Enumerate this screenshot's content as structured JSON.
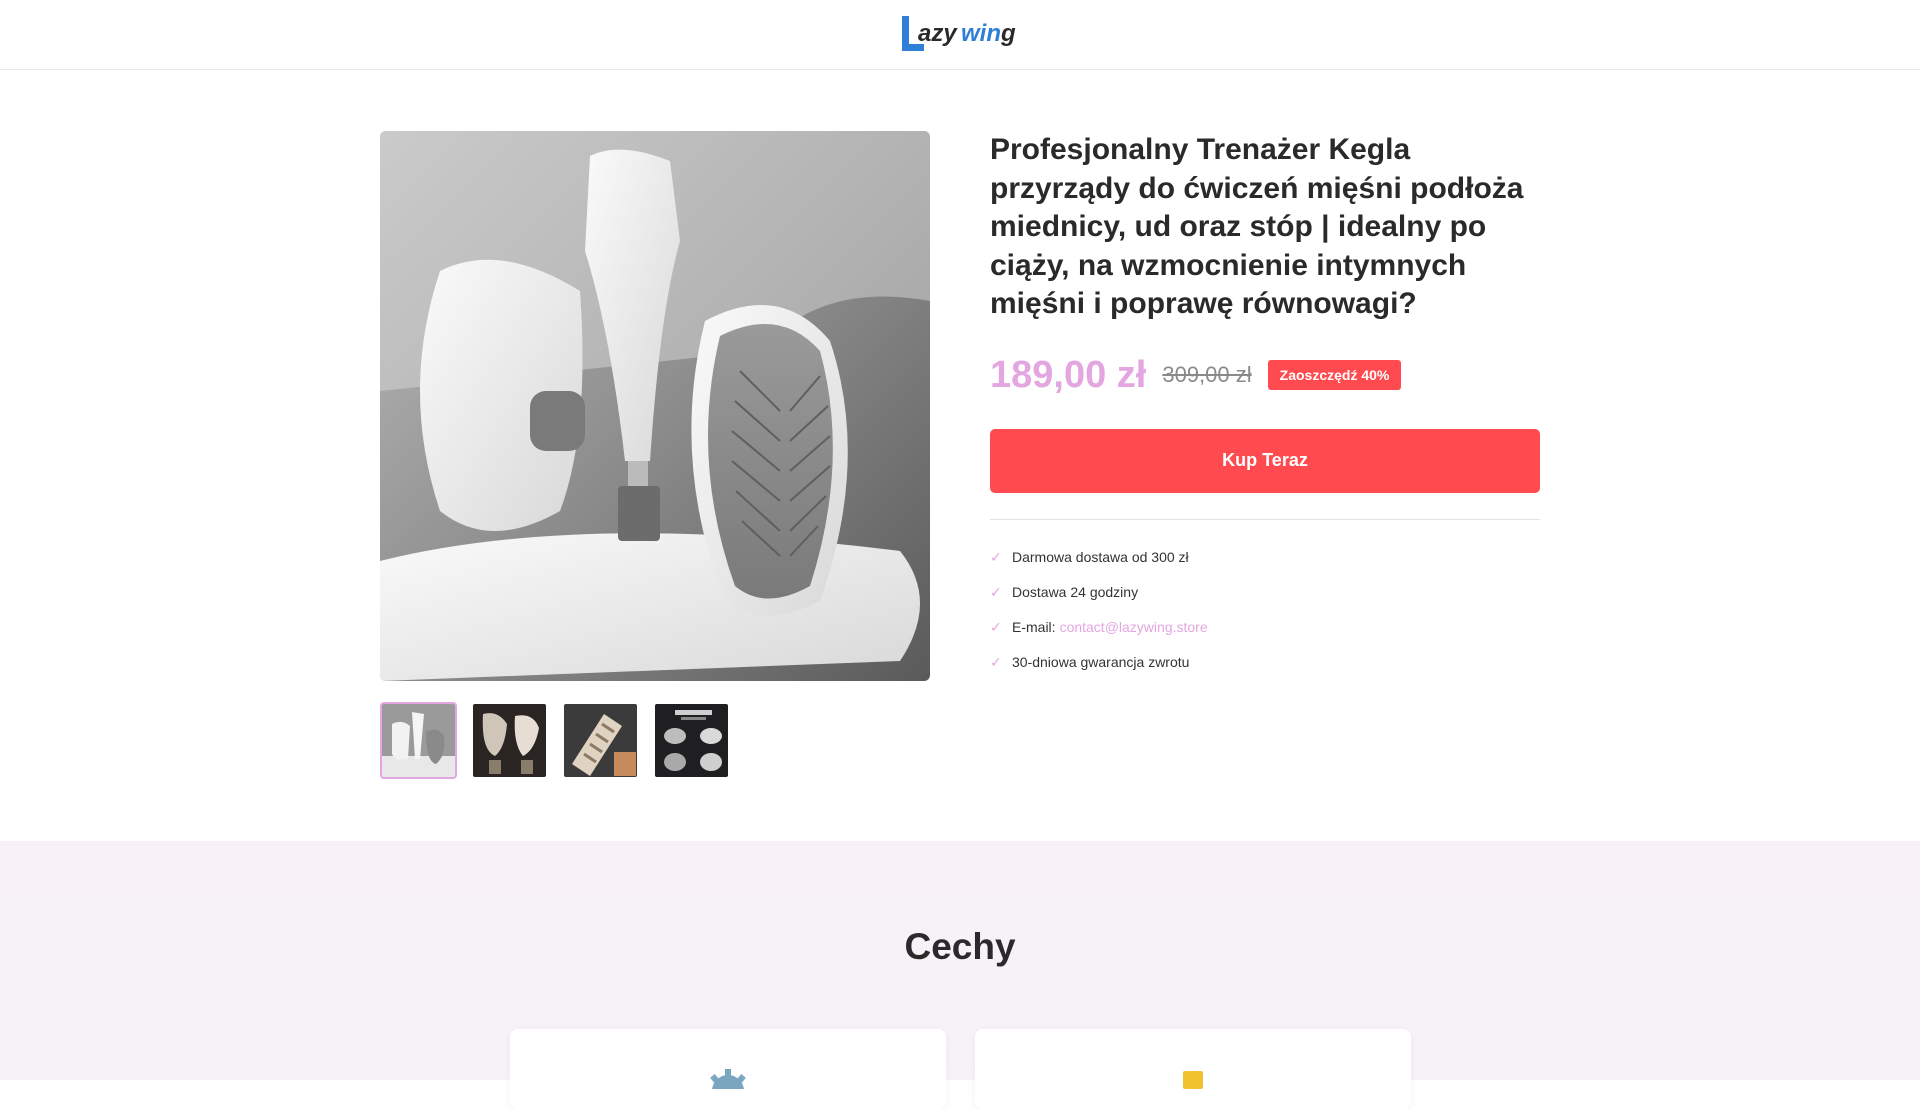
{
  "header": {
    "logo_text": "Lazywing"
  },
  "product": {
    "title": "Profesjonalny Trenażer Kegla przyrządy do ćwiczeń mięśni podłoża miednicy, ud oraz stóp | idealny po ciąży, na wzmocnienie intymnych mięśni i poprawę równowagi?",
    "price": "189,00 zł",
    "old_price": "309,00 zł",
    "save_label": "Zaoszczędź 40%",
    "buy_label": "Kup Teraz",
    "features": [
      {
        "text": "Darmowa dostawa od 300 zł"
      },
      {
        "text": "Dostawa 24 godziny"
      },
      {
        "text": "E-mail:",
        "link": "contact@lazywing.store"
      },
      {
        "text": "30-dniowa gwarancja zwrotu"
      }
    ],
    "thumbnail_count": 4,
    "active_thumbnail": 1
  },
  "features_section": {
    "title": "Cechy",
    "card_icons": [
      "gear-icon",
      "trophy-icon"
    ]
  },
  "colors": {
    "accent_pink": "#e4a6e0",
    "cta_red": "#ff4b4f",
    "logo_blue": "#2f7fd8",
    "logo_dark": "#2a2a2a"
  }
}
